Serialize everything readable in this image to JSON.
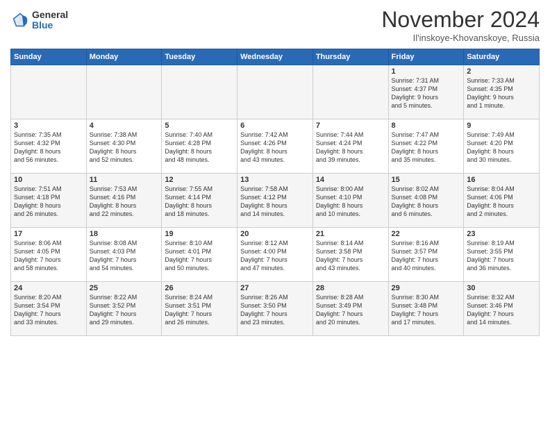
{
  "logo": {
    "general": "General",
    "blue": "Blue"
  },
  "title": "November 2024",
  "location": "Il'inskoye-Khovanskoye, Russia",
  "days": [
    "Sunday",
    "Monday",
    "Tuesday",
    "Wednesday",
    "Thursday",
    "Friday",
    "Saturday"
  ],
  "weeks": [
    [
      {
        "day": "",
        "info": ""
      },
      {
        "day": "",
        "info": ""
      },
      {
        "day": "",
        "info": ""
      },
      {
        "day": "",
        "info": ""
      },
      {
        "day": "",
        "info": ""
      },
      {
        "day": "1",
        "info": "Sunrise: 7:31 AM\nSunset: 4:37 PM\nDaylight: 9 hours\nand 5 minutes."
      },
      {
        "day": "2",
        "info": "Sunrise: 7:33 AM\nSunset: 4:35 PM\nDaylight: 9 hours\nand 1 minute."
      }
    ],
    [
      {
        "day": "3",
        "info": "Sunrise: 7:35 AM\nSunset: 4:32 PM\nDaylight: 8 hours\nand 56 minutes."
      },
      {
        "day": "4",
        "info": "Sunrise: 7:38 AM\nSunset: 4:30 PM\nDaylight: 8 hours\nand 52 minutes."
      },
      {
        "day": "5",
        "info": "Sunrise: 7:40 AM\nSunset: 4:28 PM\nDaylight: 8 hours\nand 48 minutes."
      },
      {
        "day": "6",
        "info": "Sunrise: 7:42 AM\nSunset: 4:26 PM\nDaylight: 8 hours\nand 43 minutes."
      },
      {
        "day": "7",
        "info": "Sunrise: 7:44 AM\nSunset: 4:24 PM\nDaylight: 8 hours\nand 39 minutes."
      },
      {
        "day": "8",
        "info": "Sunrise: 7:47 AM\nSunset: 4:22 PM\nDaylight: 8 hours\nand 35 minutes."
      },
      {
        "day": "9",
        "info": "Sunrise: 7:49 AM\nSunset: 4:20 PM\nDaylight: 8 hours\nand 30 minutes."
      }
    ],
    [
      {
        "day": "10",
        "info": "Sunrise: 7:51 AM\nSunset: 4:18 PM\nDaylight: 8 hours\nand 26 minutes."
      },
      {
        "day": "11",
        "info": "Sunrise: 7:53 AM\nSunset: 4:16 PM\nDaylight: 8 hours\nand 22 minutes."
      },
      {
        "day": "12",
        "info": "Sunrise: 7:55 AM\nSunset: 4:14 PM\nDaylight: 8 hours\nand 18 minutes."
      },
      {
        "day": "13",
        "info": "Sunrise: 7:58 AM\nSunset: 4:12 PM\nDaylight: 8 hours\nand 14 minutes."
      },
      {
        "day": "14",
        "info": "Sunrise: 8:00 AM\nSunset: 4:10 PM\nDaylight: 8 hours\nand 10 minutes."
      },
      {
        "day": "15",
        "info": "Sunrise: 8:02 AM\nSunset: 4:08 PM\nDaylight: 8 hours\nand 6 minutes."
      },
      {
        "day": "16",
        "info": "Sunrise: 8:04 AM\nSunset: 4:06 PM\nDaylight: 8 hours\nand 2 minutes."
      }
    ],
    [
      {
        "day": "17",
        "info": "Sunrise: 8:06 AM\nSunset: 4:05 PM\nDaylight: 7 hours\nand 58 minutes."
      },
      {
        "day": "18",
        "info": "Sunrise: 8:08 AM\nSunset: 4:03 PM\nDaylight: 7 hours\nand 54 minutes."
      },
      {
        "day": "19",
        "info": "Sunrise: 8:10 AM\nSunset: 4:01 PM\nDaylight: 7 hours\nand 50 minutes."
      },
      {
        "day": "20",
        "info": "Sunrise: 8:12 AM\nSunset: 4:00 PM\nDaylight: 7 hours\nand 47 minutes."
      },
      {
        "day": "21",
        "info": "Sunrise: 8:14 AM\nSunset: 3:58 PM\nDaylight: 7 hours\nand 43 minutes."
      },
      {
        "day": "22",
        "info": "Sunrise: 8:16 AM\nSunset: 3:57 PM\nDaylight: 7 hours\nand 40 minutes."
      },
      {
        "day": "23",
        "info": "Sunrise: 8:19 AM\nSunset: 3:55 PM\nDaylight: 7 hours\nand 36 minutes."
      }
    ],
    [
      {
        "day": "24",
        "info": "Sunrise: 8:20 AM\nSunset: 3:54 PM\nDaylight: 7 hours\nand 33 minutes."
      },
      {
        "day": "25",
        "info": "Sunrise: 8:22 AM\nSunset: 3:52 PM\nDaylight: 7 hours\nand 29 minutes."
      },
      {
        "day": "26",
        "info": "Sunrise: 8:24 AM\nSunset: 3:51 PM\nDaylight: 7 hours\nand 26 minutes."
      },
      {
        "day": "27",
        "info": "Sunrise: 8:26 AM\nSunset: 3:50 PM\nDaylight: 7 hours\nand 23 minutes."
      },
      {
        "day": "28",
        "info": "Sunrise: 8:28 AM\nSunset: 3:49 PM\nDaylight: 7 hours\nand 20 minutes."
      },
      {
        "day": "29",
        "info": "Sunrise: 8:30 AM\nSunset: 3:48 PM\nDaylight: 7 hours\nand 17 minutes."
      },
      {
        "day": "30",
        "info": "Sunrise: 8:32 AM\nSunset: 3:46 PM\nDaylight: 7 hours\nand 14 minutes."
      }
    ]
  ]
}
